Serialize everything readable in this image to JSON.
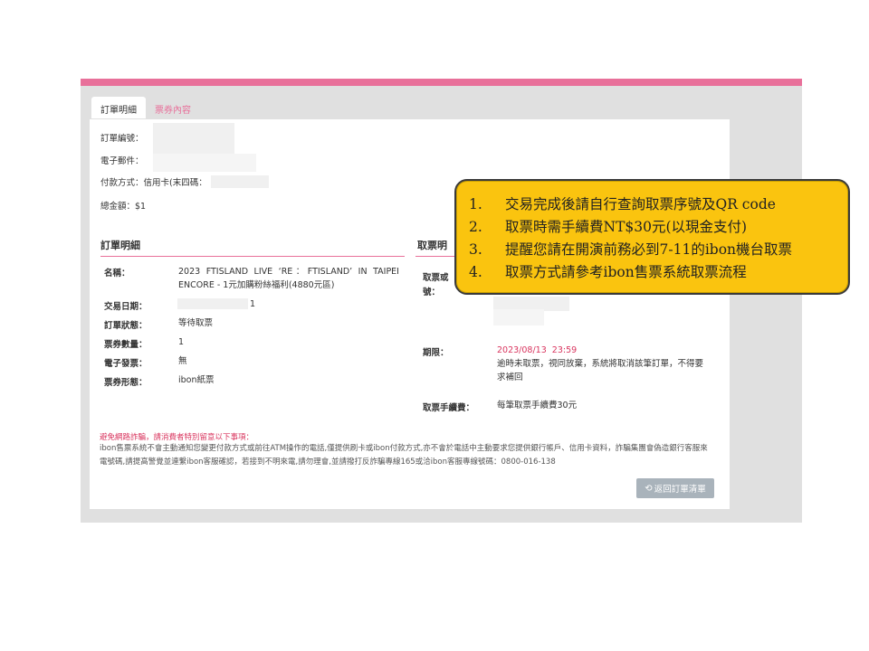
{
  "tabs": {
    "active": "訂單明細",
    "inactive": "票券內容"
  },
  "summary": {
    "order_no_label": "訂單編號：",
    "email_label": "電子郵件：",
    "payment_label": "付款方式：信用卡(末四碼：",
    "total_label": "總金額：$1"
  },
  "order_detail": {
    "title": "訂單明細",
    "rows": [
      {
        "label": "名稱：",
        "value": "2023 FTISLAND LIVE ‘RE：FTISLAND’ IN TAIPEI ENCORE - 1元加購粉絲福利(4880元區)"
      },
      {
        "label": "交易日期：",
        "value": "1"
      },
      {
        "label": "訂單狀態：",
        "value": "等待取票"
      },
      {
        "label": "票券數量：",
        "value": "1"
      },
      {
        "label": "電子發票：",
        "value": "無"
      },
      {
        "label": "票券形態：",
        "value": "ibon紙票"
      }
    ]
  },
  "pickup": {
    "title": "取票明",
    "code_label": "取票或",
    "code_label_2": "號：",
    "deadline_label": "期限：",
    "deadline_value": "2023/08/13  23:59",
    "deadline_note": "逾時未取票，視同放棄，系統將取消該筆訂單，不得要求補回",
    "fee_label": "取票手續費：",
    "fee_value": "每筆取票手續費30元"
  },
  "warning": {
    "title": "避免網路詐騙，請消費者特別留意以下事項：",
    "body": "ibon售票系統不會主動通知您變更付款方式或前往ATM操作的電話,僅提供刷卡或ibon付款方式,亦不會於電話中主動要求您提供銀行帳戶、信用卡資料，詐騙集團會偽造銀行客服來電號碼,請提高警覺並連繫ibon客服確認，若接到不明來電,請勿理會,並請撥打反詐騙專線165或洽ibon客服專線號碼：0800-016-138"
  },
  "back_button": "返回訂單清單",
  "callout": {
    "items": [
      {
        "num": "1.",
        "text": "交易完成後請自行查詢取票序號及QR code"
      },
      {
        "num": "2.",
        "text": "取票時需手續費NT$30元(以現金支付)"
      },
      {
        "num": "3.",
        "text": "提醒您請在開演前務必到7-11的ibon機台取票"
      },
      {
        "num": "4.",
        "text": "取票方式請參考ibon售票系統取票流程"
      }
    ]
  },
  "colors": {
    "accent": "#e8709a",
    "callout": "#fac40f",
    "deadline": "#d9345e"
  },
  "icons": {
    "back_button": "return-arrow-icon"
  }
}
